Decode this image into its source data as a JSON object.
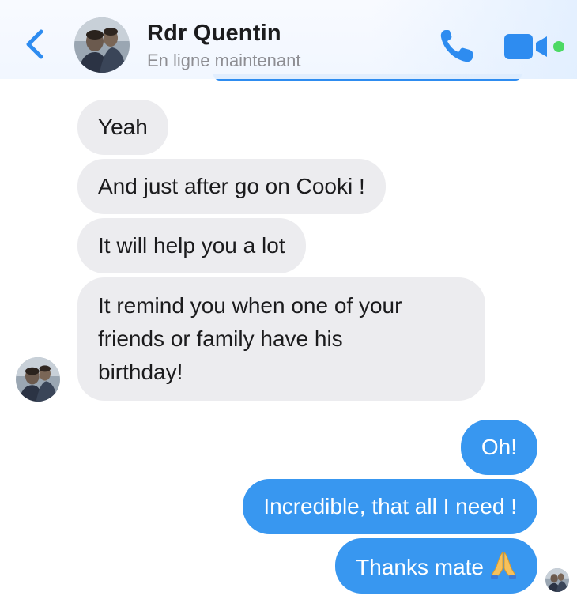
{
  "header": {
    "contact_name": "Rdr Quentin",
    "status": "En ligne maintenant",
    "accent_color": "#2e8cf0",
    "online_color": "#4cd964"
  },
  "messages": {
    "received": [
      {
        "text": "Yeah"
      },
      {
        "text": "And just after go on Cooki !"
      },
      {
        "text": "It will help you a lot"
      },
      {
        "text_lines": [
          "It remind you when one of your",
          "friends or family have his",
          "birthday!"
        ]
      }
    ],
    "sent": [
      {
        "text": "Oh!"
      },
      {
        "text": "Incredible, that all I need !"
      },
      {
        "text": "Thanks mate",
        "emoji": "folded-hands-emoji"
      }
    ]
  },
  "colors": {
    "sent_bubble": "#3897f0",
    "received_bubble": "#ececef"
  }
}
